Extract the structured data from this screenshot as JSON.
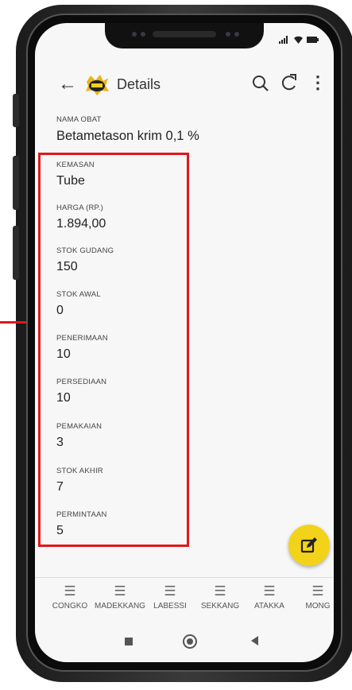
{
  "status": {
    "icons": "signal wifi battery"
  },
  "appbar": {
    "title": "Details",
    "back_icon": "arrow-left-icon",
    "logo": "app-logo",
    "search_icon": "search-icon",
    "refresh_icon": "refresh-icon",
    "more_icon": "more-vert-icon"
  },
  "fields": [
    {
      "label": "NAMA OBAT",
      "value": "Betametason krim 0,1 %"
    },
    {
      "label": "KEMASAN",
      "value": "Tube"
    },
    {
      "label": "HARGA (Rp.)",
      "value": "1.894,00"
    },
    {
      "label": "STOK GUDANG",
      "value": "150"
    },
    {
      "label": "STOK AWAL",
      "value": "0"
    },
    {
      "label": "PENERIMAAN",
      "value": "10"
    },
    {
      "label": "PERSEDIAAN",
      "value": "10"
    },
    {
      "label": "PEMAKAIAN",
      "value": "3"
    },
    {
      "label": "STOK AKHIR",
      "value": "7"
    },
    {
      "label": "PERMINTAAN",
      "value": "5"
    }
  ],
  "fab": {
    "icon": "edit-icon",
    "color": "#f3d319"
  },
  "bottom_nav": [
    {
      "label": "CONGKO"
    },
    {
      "label": "MADEKKANG"
    },
    {
      "label": "LABESSI"
    },
    {
      "label": "SEKKANG"
    },
    {
      "label": "ATAKKA"
    },
    {
      "label": "MONG"
    }
  ],
  "colors": {
    "highlight": "#e0171b",
    "accent": "#f3d319"
  }
}
